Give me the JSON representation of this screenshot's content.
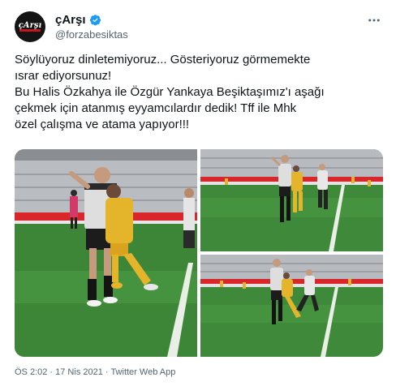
{
  "author": {
    "display_name": "çArşı",
    "handle": "@forzabesiktas",
    "verified": true,
    "avatar_text": "çArşı"
  },
  "icons": {
    "verified": "verified-badge-icon",
    "more": "more-horizontal-icon"
  },
  "tweet": {
    "lines": [
      "Söylüyoruz dinletemiyoruz... Gösteriyoruz görmemekte",
      "ısrar ediyorsunuz!",
      "Bu Halis Özkahya ile Özgür Yankaya Beşiktaşımız'ı aşağı",
      "çekmek için atanmış eyyamcılardır dedik! Tff ile Mhk",
      "özel çalışma ve atama yapıyor!!!"
    ]
  },
  "media": {
    "photos": [
      "match-photo-main",
      "match-photo-top-right",
      "match-photo-bottom-right"
    ]
  },
  "meta": {
    "time": "ÖS 2:02",
    "separator": " · ",
    "date": "17 Nis 2021",
    "source": "Twitter Web App"
  },
  "colors": {
    "accent": "#1d9bf0",
    "pitch": "#3f8a3a",
    "muted": "#536471"
  }
}
